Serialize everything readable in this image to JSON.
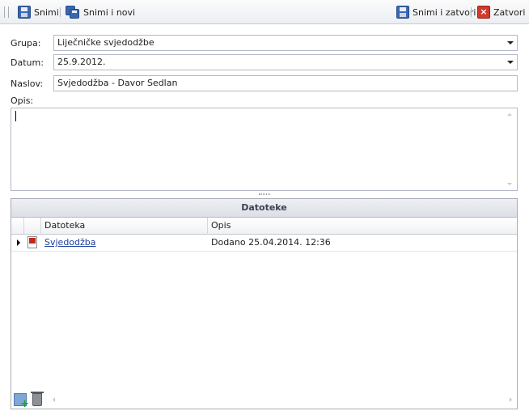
{
  "toolbar": {
    "save_label": "Snimi",
    "save_new_label": "Snimi i novi",
    "save_close_label": "Snimi i zatvori",
    "close_label": "Zatvori"
  },
  "form": {
    "group_label": "Grupa:",
    "group_value": "Liječničke svjedodžbe",
    "date_label": "Datum:",
    "date_value": "25.9.2012.",
    "title_label": "Naslov:",
    "title_value": "Svjedodžba - Davor Sedlan",
    "description_label": "Opis:",
    "description_value": ""
  },
  "files": {
    "title": "Datoteke",
    "columns": [
      "Datoteka",
      "Opis"
    ],
    "rows": [
      {
        "file": "Svjedodžba",
        "description": "Dodano 25.04.2014. 12:36",
        "icon": "pdf-icon"
      }
    ]
  },
  "colors": {
    "accent_blue": "#3b67b1",
    "close_red": "#d23a2c",
    "link": "#1d3e9c"
  }
}
